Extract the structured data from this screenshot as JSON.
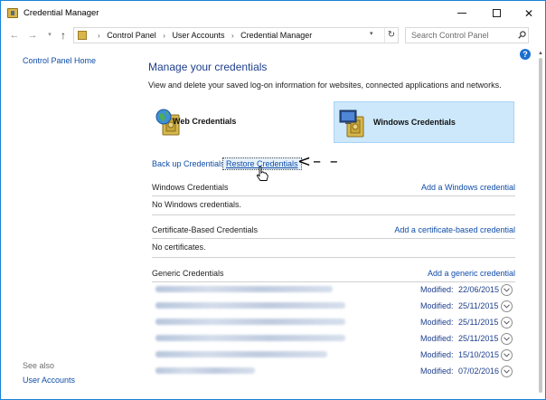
{
  "window": {
    "title": "Credential Manager",
    "minimize_label": "",
    "maximize_label": "",
    "close_label": "✕"
  },
  "nav": {
    "breadcrumbs": [
      "Control Panel",
      "User Accounts",
      "Credential Manager"
    ],
    "search_placeholder": "Search Control Panel"
  },
  "sidebar": {
    "home_link": "Control Panel Home",
    "see_also": "See also",
    "user_accounts_link": "User Accounts"
  },
  "main": {
    "heading": "Manage your credentials",
    "description": "View and delete your saved log-on information for websites, connected applications and networks.",
    "web_credentials": "Web Credentials",
    "windows_credentials": "Windows Credentials",
    "backup_link": "Back up Credentials",
    "restore_link": "Restore Credentials",
    "annotation_arrow": "<– –",
    "sections": {
      "windows": {
        "title": "Windows Credentials",
        "add_link": "Add a Windows credential",
        "empty": "No Windows credentials."
      },
      "certificate": {
        "title": "Certificate-Based Credentials",
        "add_link": "Add a certificate-based credential",
        "empty": "No certificates."
      },
      "generic": {
        "title": "Generic Credentials",
        "add_link": "Add a generic credential"
      }
    },
    "modified_label": "Modified:",
    "generic_items": [
      {
        "date": "22/06/2015"
      },
      {
        "date": "25/11/2015"
      },
      {
        "date": "25/11/2015"
      },
      {
        "date": "25/11/2015"
      },
      {
        "date": "15/10/2015"
      },
      {
        "date": "07/02/2016"
      }
    ]
  },
  "colors": {
    "accent_link": "#0f4da8",
    "heading": "#1e3f8c",
    "selected_tile": "#cde8fb",
    "window_border": "#1883d7"
  }
}
